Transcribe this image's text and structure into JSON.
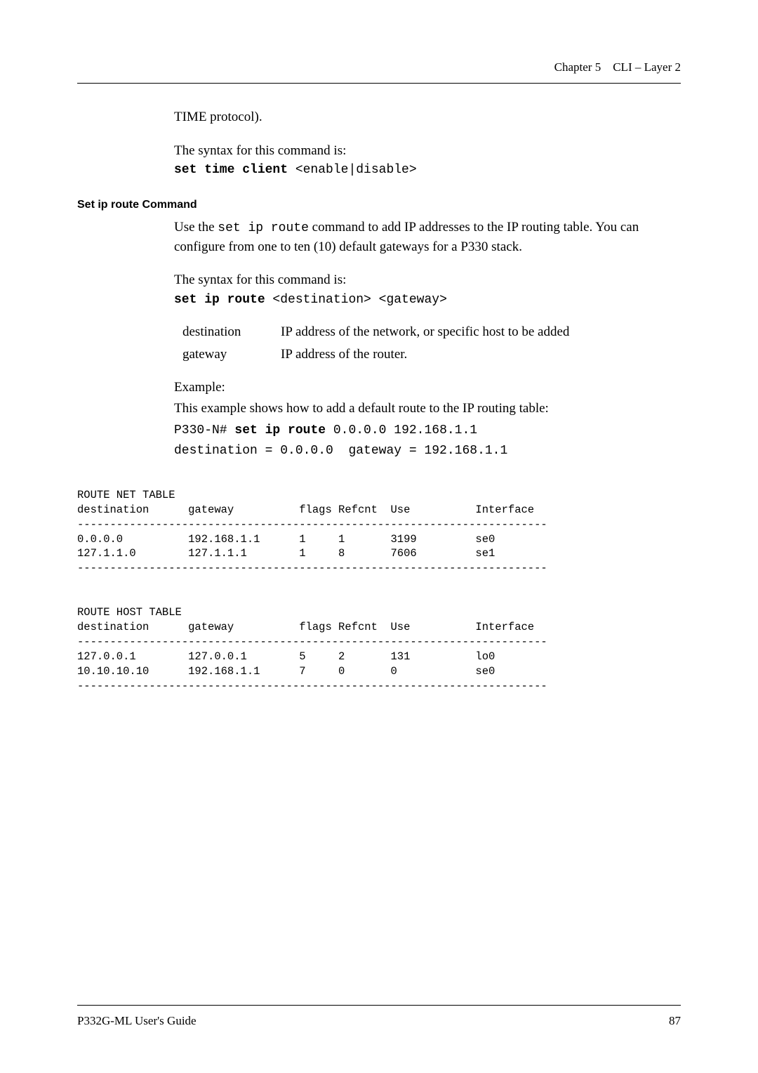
{
  "header": {
    "chapter": "Chapter 5",
    "title": "CLI – Layer 2"
  },
  "body": {
    "time_protocol": "TIME protocol).",
    "syntax_intro_1": "The syntax for this command is:",
    "cmd1_bold": "set time client",
    "cmd1_rest": " <enable|disable>",
    "section_label": "Set ip route Command",
    "p2a": "Use the ",
    "p2_mono": "set ip route",
    "p2b": " command to add IP addresses to the IP routing table. You can configure from one to ten (10) default gateways for a P330 stack.",
    "syntax_intro_2": "The syntax for this command is:",
    "cmd2_bold": "set ip route",
    "cmd2_rest": " <destination> <gateway>",
    "def1_term": "destination",
    "def1_def": "IP address of the network, or specific host to be added",
    "def2_term": "gateway",
    "def2_def": "IP address of the router.",
    "example_label": "Example:",
    "example_intro": "This example shows how to add a default route to the IP routing table:",
    "ex_line1_a": "P330-N# ",
    "ex_line1_bold": "set ip route",
    "ex_line1_b": " 0.0.0.0 192.168.1.1",
    "ex_line2": "destination = 0.0.0.0  gateway = 192.168.1.1",
    "table1_title": "ROUTE NET TABLE",
    "table1_header": "destination      gateway          flags Refcnt  Use          Interface",
    "table1_sep": "------------------------------------------------------------------------",
    "table1_r1": "0.0.0.0          192.168.1.1      1     1       3199         se0",
    "table1_r2": "127.1.1.0        127.1.1.1        1     8       7606         se1",
    "table1_sep2": "------------------------------------------------------------------------",
    "table2_title": "ROUTE HOST TABLE",
    "table2_header": "destination      gateway          flags Refcnt  Use          Interface",
    "table2_sep": "------------------------------------------------------------------------",
    "table2_r1": "127.0.0.1        127.0.0.1        5     2       131          lo0",
    "table2_r2": "10.10.10.10      192.168.1.1      7     0       0            se0",
    "table2_sep2": "------------------------------------------------------------------------"
  },
  "footer": {
    "left": "P332G-ML User's Guide",
    "right": "87"
  },
  "chart_data": {
    "type": "table",
    "tables": [
      {
        "title": "ROUTE NET TABLE",
        "columns": [
          "destination",
          "gateway",
          "flags",
          "Refcnt",
          "Use",
          "Interface"
        ],
        "rows": [
          [
            "0.0.0.0",
            "192.168.1.1",
            1,
            1,
            3199,
            "se0"
          ],
          [
            "127.1.1.0",
            "127.1.1.1",
            1,
            8,
            7606,
            "se1"
          ]
        ]
      },
      {
        "title": "ROUTE HOST TABLE",
        "columns": [
          "destination",
          "gateway",
          "flags",
          "Refcnt",
          "Use",
          "Interface"
        ],
        "rows": [
          [
            "127.0.0.1",
            "127.0.0.1",
            5,
            2,
            131,
            "lo0"
          ],
          [
            "10.10.10.10",
            "192.168.1.1",
            7,
            0,
            0,
            "se0"
          ]
        ]
      }
    ]
  }
}
